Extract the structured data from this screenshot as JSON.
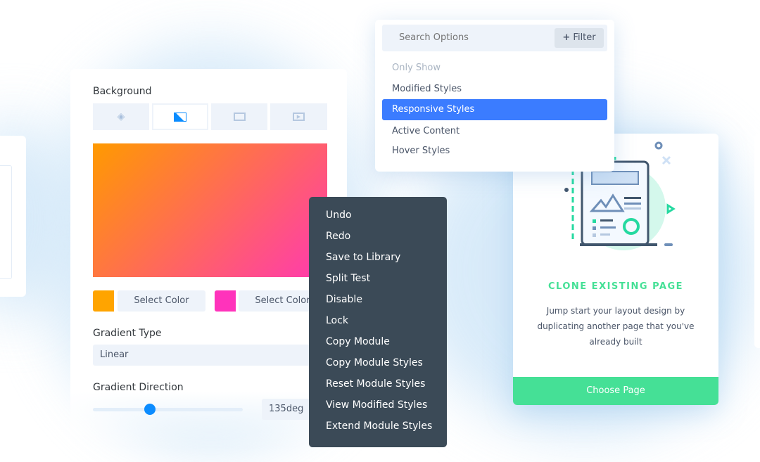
{
  "background_panel": {
    "title": "Background",
    "tabs": [
      {
        "icon": "paint-bucket-icon"
      },
      {
        "icon": "gradient-icon",
        "active": true
      },
      {
        "icon": "image-icon"
      },
      {
        "icon": "video-icon"
      }
    ],
    "gradient_colors": [
      "#ff9a00",
      "#ff3ab0"
    ],
    "color_1": {
      "swatch": "#ffa400",
      "label": "Select Color"
    },
    "color_2": {
      "swatch": "#ff33bb",
      "label": "Select Color"
    },
    "gradient_type_label": "Gradient Type",
    "gradient_type_value": "Linear",
    "gradient_direction_label": "Gradient Direction",
    "gradient_direction_value": "135deg",
    "slider_fraction": 0.38
  },
  "search_dropdown": {
    "placeholder": "Search Options",
    "filter_label": "Filter",
    "section_label": "Only Show",
    "items": [
      "Modified Styles",
      "Responsive Styles",
      "Active Content",
      "Hover Styles"
    ],
    "selected": "Responsive Styles",
    "accent": "#3b7cff"
  },
  "context_menu": {
    "items": [
      "Undo",
      "Redo",
      "Save to Library",
      "Split Test",
      "Disable",
      "Lock",
      "Copy Module",
      "Copy Module Styles",
      "Reset Module Styles",
      "View Modified Styles",
      "Extend Module Styles"
    ]
  },
  "clone_card": {
    "title": "CLONE EXISTING PAGE",
    "description": "Jump start your layout design by duplicating another page that you've already built",
    "button_label": "Choose Page",
    "accent": "#45e096"
  }
}
